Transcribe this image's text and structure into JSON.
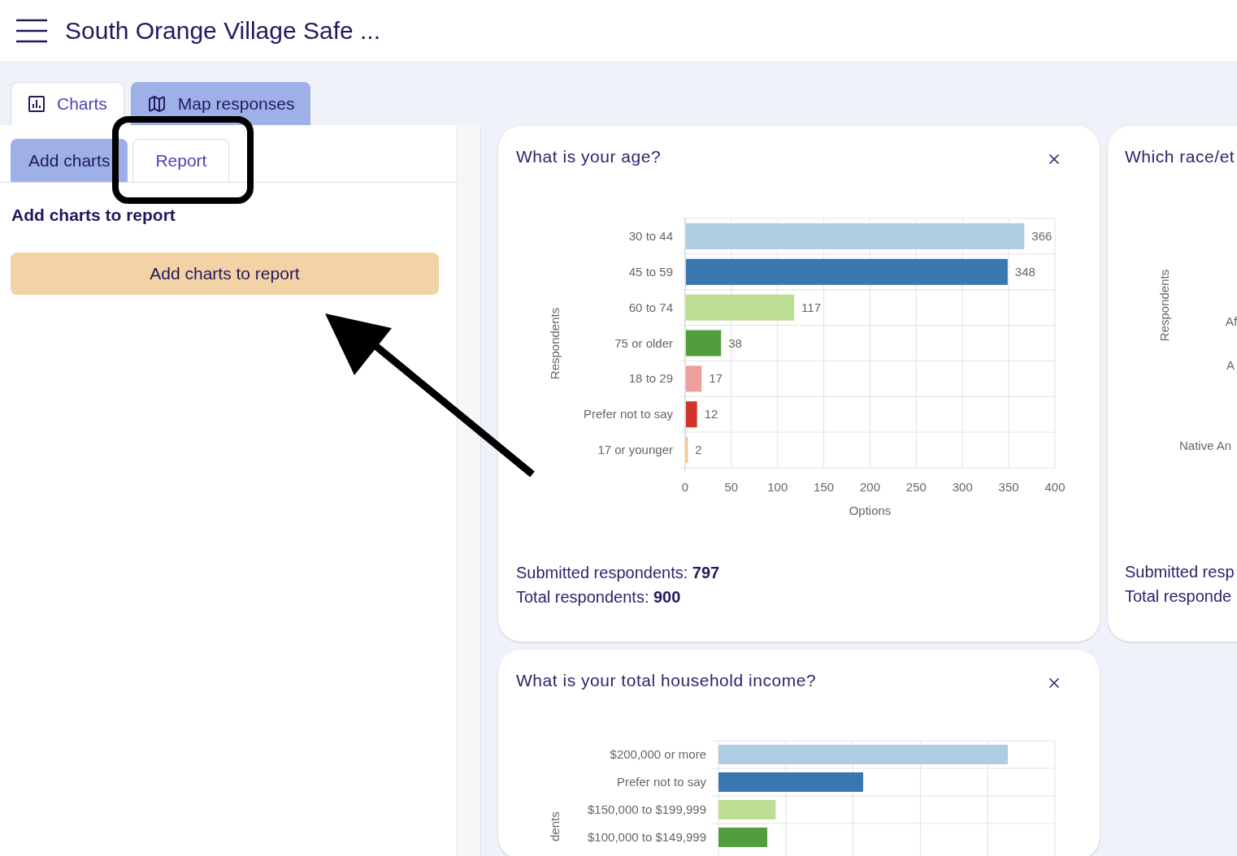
{
  "header": {
    "title": "South Orange Village Safe ..."
  },
  "tabs": [
    {
      "label": "Charts",
      "kind": "chart",
      "selected": true
    },
    {
      "label": "Map responses",
      "kind": "map",
      "selected": false
    }
  ],
  "side_tabs": [
    {
      "label": "Add charts",
      "selected": false
    },
    {
      "label": "Report",
      "selected": true
    }
  ],
  "side_panel": {
    "heading": "Add charts to report",
    "button": "Add charts to report"
  },
  "cards": [
    {
      "title": "What is your age?",
      "chart_data": {
        "type": "bar",
        "orientation": "horizontal",
        "xlabel": "Options",
        "ylabel": "Respondents",
        "categories": [
          "30 to 44",
          "45 to 59",
          "60 to 74",
          "75 or older",
          "18 to 29",
          "Prefer not to say",
          "17 or younger"
        ],
        "series": [
          {
            "values": [
              366,
              348,
              117,
              38,
              17,
              12,
              2
            ]
          }
        ],
        "xlim": [
          0,
          400
        ],
        "xticks": [
          0,
          50,
          100,
          150,
          200,
          250,
          300,
          350,
          400
        ],
        "grid": true,
        "data_labels": true
      },
      "bar_styles": [
        {
          "color": "#aecde1"
        },
        {
          "color": "#3b76af"
        },
        {
          "color": "#bbde93"
        },
        {
          "color": "#519e3e"
        },
        {
          "color": "#ed9f9b"
        },
        {
          "color": "#d0342b"
        },
        {
          "color": "#f4c389"
        }
      ],
      "footer": [
        {
          "label": "Submitted respondents: ",
          "value": "797"
        },
        {
          "label": "Total respondents: ",
          "value": "900"
        }
      ]
    },
    {
      "title": "What is your total household income?",
      "ylabel": "dents",
      "bars": [
        {
          "label": "$200,000 or more",
          "color": "#aecde1",
          "level": 0.86
        },
        {
          "label": "Prefer not to say",
          "color": "#3b76af",
          "level": 0.43
        },
        {
          "label": "$150,000 to $199,999",
          "color": "#bbde93",
          "level": 0.17
        },
        {
          "label": "$100,000 to $149,999",
          "color": "#519e3e",
          "level": 0.145
        }
      ]
    }
  ],
  "side_card": {
    "title": "Which race/et",
    "ylabel": "Respondents",
    "labels": [
      "Af",
      "A",
      "Native An"
    ],
    "footer": [
      "Submitted resp",
      "Total responde"
    ]
  }
}
